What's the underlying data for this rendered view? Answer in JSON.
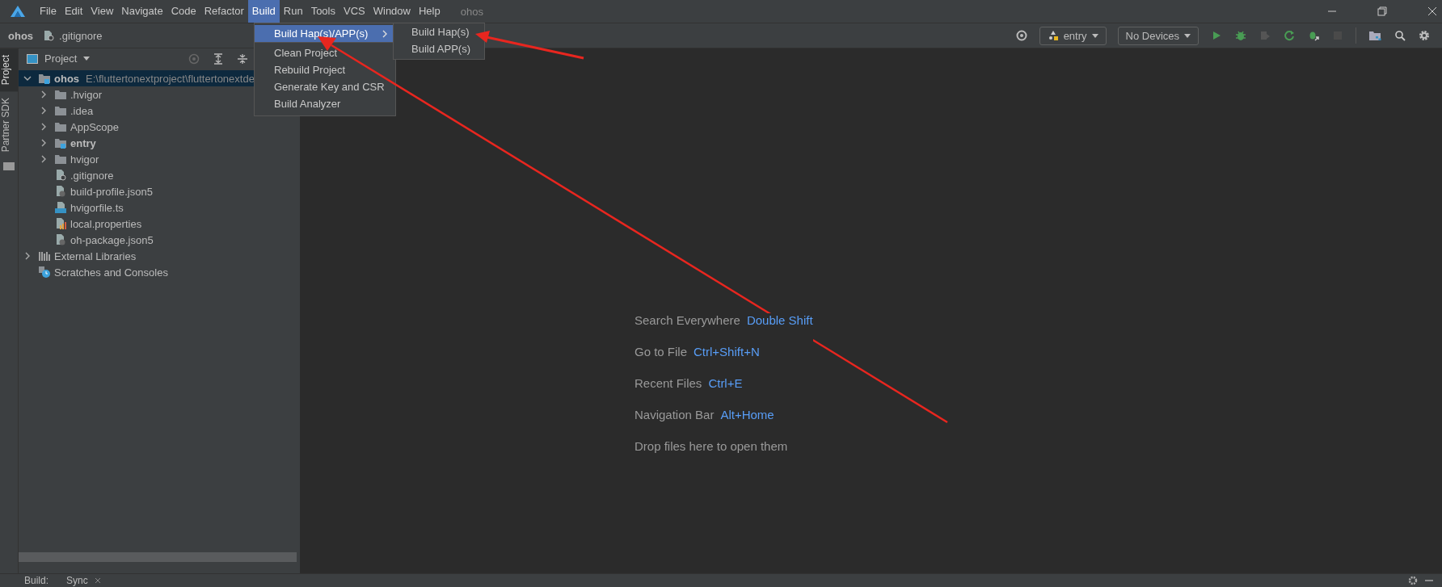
{
  "menu_bar": {
    "items": [
      {
        "label": "File",
        "selected": false
      },
      {
        "label": "Edit",
        "selected": false
      },
      {
        "label": "View",
        "selected": false
      },
      {
        "label": "Navigate",
        "selected": false
      },
      {
        "label": "Code",
        "selected": false
      },
      {
        "label": "Refactor",
        "selected": false
      },
      {
        "label": "Build",
        "selected": true
      },
      {
        "label": "Run",
        "selected": false
      },
      {
        "label": "Tools",
        "selected": false
      },
      {
        "label": "VCS",
        "selected": false
      },
      {
        "label": "Window",
        "selected": false
      },
      {
        "label": "Help",
        "selected": false
      }
    ],
    "project_title": "ohos"
  },
  "build_menu": {
    "items": [
      {
        "label": "Build Hap(s)/APP(s)",
        "selected": true,
        "submenu": true
      },
      {
        "label": "Clean Project",
        "selected": false,
        "submenu": false
      },
      {
        "label": "Rebuild Project",
        "selected": false,
        "submenu": false
      },
      {
        "label": "Generate Key and CSR",
        "selected": false,
        "submenu": false
      },
      {
        "label": "Build Analyzer",
        "selected": false,
        "submenu": false
      }
    ]
  },
  "submenu": {
    "items": [
      {
        "label": "Build Hap(s)",
        "selected": false
      },
      {
        "label": "Build APP(s)",
        "selected": false
      }
    ]
  },
  "breadcrumb": [
    "ohos",
    ".gitignore"
  ],
  "toolbar": {
    "module": "entry",
    "device": "No Devices"
  },
  "side_tabs": [
    {
      "label": "Project",
      "selected": true
    },
    {
      "label": "Partner SDK",
      "selected": false
    }
  ],
  "project_panel": {
    "title": "Project",
    "tree": [
      {
        "label": "ohos",
        "kind": "module",
        "path": "E:\\fluttertonextproject\\fluttertonextde",
        "expanded": true,
        "selected": true,
        "children": [
          {
            "label": ".hvigor",
            "kind": "folder",
            "expanded": false,
            "selected": false
          },
          {
            "label": ".idea",
            "kind": "folder",
            "expanded": false,
            "selected": false
          },
          {
            "label": "AppScope",
            "kind": "folder",
            "expanded": false,
            "selected": false
          },
          {
            "label": "entry",
            "kind": "module",
            "expanded": false,
            "selected": false
          },
          {
            "label": "hvigor",
            "kind": "folder",
            "expanded": false,
            "selected": false
          },
          {
            "label": ".gitignore",
            "kind": "ignore",
            "selected": false
          },
          {
            "label": "build-profile.json5",
            "kind": "json",
            "selected": false
          },
          {
            "label": "hvigorfile.ts",
            "kind": "ts",
            "selected": false
          },
          {
            "label": "local.properties",
            "kind": "properties",
            "selected": false
          },
          {
            "label": "oh-package.json5",
            "kind": "json",
            "selected": false
          }
        ]
      },
      {
        "label": "External Libraries",
        "kind": "libraries",
        "expanded": false,
        "selected": false
      },
      {
        "label": "Scratches and Consoles",
        "kind": "scratches",
        "selected": false
      }
    ]
  },
  "welcome": [
    {
      "label": "Search Everywhere",
      "shortcut": "Double Shift"
    },
    {
      "label": "Go to File",
      "shortcut": "Ctrl+Shift+N"
    },
    {
      "label": "Recent Files",
      "shortcut": "Ctrl+E"
    },
    {
      "label": "Navigation Bar",
      "shortcut": "Alt+Home"
    },
    {
      "label": "Drop files here to open them"
    }
  ],
  "bottom_bar": {
    "label": "Build:",
    "tabs": [
      {
        "label": "Sync"
      }
    ]
  }
}
